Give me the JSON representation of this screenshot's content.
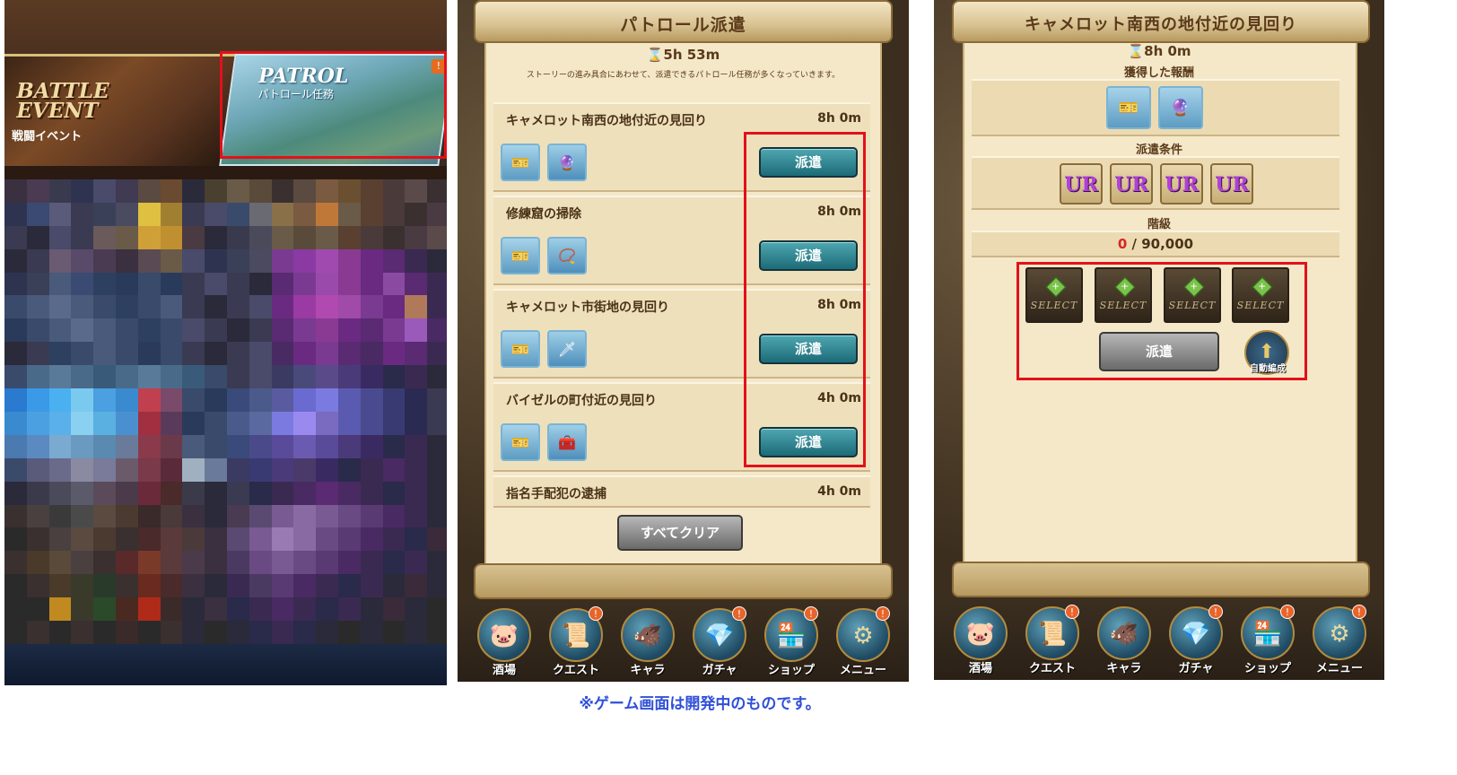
{
  "panel1": {
    "battle_title": "BATTLE EVENT",
    "battle_subtitle": "戦闘イベント",
    "patrol_title": "PATROL",
    "patrol_subtitle": "パトロール任務",
    "patrol_badge": "!",
    "mosaic_colors": [
      "#3a3040",
      "#4a3a52",
      "#3a3a4e",
      "#2e3450",
      "#4a4a6a",
      "#403a52",
      "#5a4a40",
      "#6a4a30",
      "#2a2a3a",
      "#4a4030",
      "#6a5a48",
      "#5a4a3a",
      "#3a3030",
      "#5a4a40",
      "#7a5a40",
      "#6a5030",
      "#5a4030",
      "#4a3a3a",
      "#5a4a4a",
      "#3a3032",
      "#2e3450",
      "#3a4a72",
      "#5a5a7a",
      "#3a3a52",
      "#3a4058",
      "#4a4a60",
      "#e0c040",
      "#a08030",
      "#3a3a52",
      "#4a4a6a",
      "#3a4a6a",
      "#6a6a72",
      "#8a7048",
      "#7a5a40",
      "#c07838",
      "#6a5a48",
      "#5a4030",
      "#4a3a3a",
      "#3a3030",
      "#4a3a42",
      "#3a3a52",
      "#2a2a3a",
      "#4a4a6a",
      "#3a3a52",
      "#6a5a5a",
      "#6a5a48",
      "#d0a038",
      "#c09030",
      "#4a3a42",
      "#2a2a3a",
      "#3a3a4e",
      "#4a4a5a",
      "#6a5a48",
      "#5a4a3a",
      "#6a5a48",
      "#5a4030",
      "#4a3a3a",
      "#3a3030",
      "#4a3a42",
      "#5a4a4a",
      "#2a2a3a",
      "#3a3a52",
      "#6a5a72",
      "#5a4a6a",
      "#4a3a52",
      "#3a3040",
      "#5a4a52",
      "#6a5a48",
      "#4a4a6a",
      "#2e3450",
      "#3a4058",
      "#4a4a60",
      "#7a3a92",
      "#8a3aa2",
      "#a04ab0",
      "#8a3a92",
      "#6a2a82",
      "#5a2a72",
      "#3a2a52",
      "#2a2a3a",
      "#2e3450",
      "#3a4058",
      "#4a5a7a",
      "#3a4a72",
      "#2e4060",
      "#2a3a5a",
      "#3a4a6a",
      "#2a3a5a",
      "#3a3a52",
      "#4a4a6a",
      "#3a3a52",
      "#2a2a3a",
      "#5a2a72",
      "#7a3a92",
      "#9a4aaa",
      "#8a3a92",
      "#6a2a82",
      "#8a4aa2",
      "#5a2a72",
      "#3a2a52",
      "#3a4a6a",
      "#4a5a7a",
      "#5a6a8a",
      "#4a5a7a",
      "#3a4a6a",
      "#2e4060",
      "#3a4a6a",
      "#4a5a7a",
      "#3a3a52",
      "#2a2a3a",
      "#3a3a52",
      "#4a4a6a",
      "#6a2a82",
      "#9a3aa2",
      "#b04ab0",
      "#a04aaa",
      "#7a3a92",
      "#6a2a82",
      "#b07a5a",
      "#3a2a52",
      "#2a3a5a",
      "#3a4a6a",
      "#4a5a7a",
      "#5a6a8a",
      "#4a5a7a",
      "#3a4a6a",
      "#2e4060",
      "#3a4a6a",
      "#4a4a6a",
      "#3a3a52",
      "#2a2a3a",
      "#3a3a52",
      "#5a2a72",
      "#7a3a92",
      "#8a3a92",
      "#6a2a82",
      "#5a2a72",
      "#7a3a92",
      "#9a5aba",
      "#4a2a62",
      "#2a2a3a",
      "#3a3a52",
      "#2e4060",
      "#3a4a6a",
      "#4a5a7a",
      "#3a4a6a",
      "#2a3a5a",
      "#3a4a6a",
      "#3a3a52",
      "#2a2a3a",
      "#3a3a52",
      "#4a4a6a",
      "#4a2a62",
      "#6a2a82",
      "#7a3a92",
      "#5a2a72",
      "#4a2a62",
      "#6a2a82",
      "#5a2a72",
      "#3a2a52",
      "#3a4a6a",
      "#4a6a8a",
      "#5a7a9a",
      "#4a6a8a",
      "#3a5a7a",
      "#4a6a8a",
      "#5a7a9a",
      "#4a6a8a",
      "#3a5a7a",
      "#3a4a6a",
      "#3a3a52",
      "#4a4a6a",
      "#3a3a62",
      "#4a4a7a",
      "#5a4a8a",
      "#4a3a7a",
      "#3a2a62",
      "#2a2a4a",
      "#3a2a52",
      "#2a2a3a",
      "#2a7ad0",
      "#3a9ae8",
      "#4ab0f0",
      "#7acaf0",
      "#4aa0e0",
      "#3a8ad0",
      "#c04050",
      "#7a4a6a",
      "#3a4a6a",
      "#2a3a5a",
      "#3a4a7a",
      "#4a5a8a",
      "#5a5aa0",
      "#6a6ad0",
      "#7a7ae0",
      "#5a5ab0",
      "#4a4a90",
      "#3a3a72",
      "#2a2a52",
      "#3a3a52",
      "#3a8ad0",
      "#4aa0e0",
      "#5ab0e8",
      "#8ad0f0",
      "#5ab0e0",
      "#4a90d0",
      "#a03040",
      "#5a3a5a",
      "#2a3a5a",
      "#3a4a6a",
      "#4a5a8a",
      "#5a6aa0",
      "#7a7ae0",
      "#9a8af0",
      "#7a6ac0",
      "#5a5ab0",
      "#4a4a90",
      "#3a3a72",
      "#2a2a52",
      "#3a3a52",
      "#4a7ab0",
      "#5a8ac0",
      "#7aaad0",
      "#6a9ac0",
      "#5a8ab0",
      "#6a7a9a",
      "#8a3a4a",
      "#6a3a4a",
      "#4a5a7a",
      "#3a4a6a",
      "#3a4a7a",
      "#4a4a8a",
      "#5a4a9a",
      "#6a5ab0",
      "#5a4a9a",
      "#4a3a7a",
      "#3a2a62",
      "#2a2a4a",
      "#3a2a52",
      "#2a2a3a",
      "#3a4a6a",
      "#5a5a7a",
      "#6a6a8a",
      "#8a8aa0",
      "#7a7a9a",
      "#6a5a6a",
      "#7a3a4a",
      "#5a2a3a",
      "#a0b0c0",
      "#6a7a9a",
      "#3a3a62",
      "#3a3a72",
      "#4a3a7a",
      "#4a3a6a",
      "#3a2a62",
      "#2a2a4a",
      "#3a2a52",
      "#4a2a62",
      "#3a2a52",
      "#2a2a3a",
      "#2a2a3a",
      "#3a3a4a",
      "#4a4a5a",
      "#5a5a6a",
      "#5a4a5a",
      "#4a3a4a",
      "#6a2a3a",
      "#4a2a2a",
      "#3a3a4a",
      "#2a2a3a",
      "#3a3a52",
      "#2a2a4a",
      "#3a2a52",
      "#4a2a62",
      "#5a2a72",
      "#4a2a62",
      "#3a2a52",
      "#2a2a4a",
      "#3a2a52",
      "#2a2a3a",
      "#3a3030",
      "#4a4040",
      "#3a3a3a",
      "#4a4a4a",
      "#5a4a40",
      "#4a3a30",
      "#3a2a2a",
      "#4a3a3a",
      "#3a3040",
      "#2a2a3a",
      "#4a3a52",
      "#5a4a72",
      "#7a5a92",
      "#8a6aa2",
      "#7a5a92",
      "#6a4a82",
      "#5a3a72",
      "#4a2a62",
      "#3a2a52",
      "#2a2a3a",
      "#2a2a2a",
      "#3a3030",
      "#4a4040",
      "#5a4a40",
      "#4a3a30",
      "#3a3030",
      "#4a2a2a",
      "#5a3a3a",
      "#4a3a3a",
      "#3a3040",
      "#5a4a72",
      "#7a5a92",
      "#9a7ab2",
      "#8a6aa2",
      "#6a4a82",
      "#5a3a72",
      "#4a2a62",
      "#3a2a52",
      "#2a2a4a",
      "#3a2a3a",
      "#3a3030",
      "#4a3a2a",
      "#5a4a3a",
      "#4a4040",
      "#3a3030",
      "#5a2a2a",
      "#7a3a2a",
      "#5a3a3a",
      "#4a3a4a",
      "#3a3040",
      "#4a3a62",
      "#6a4a82",
      "#7a5a92",
      "#6a4a82",
      "#5a3a72",
      "#4a2a62",
      "#3a2a52",
      "#2a2a4a",
      "#3a2a52",
      "#2a2a3a",
      "#2a2a2a",
      "#3a3030",
      "#4a3a2a",
      "#3a3a2a",
      "#2a3a2a",
      "#3a3030",
      "#6a2a20",
      "#4a2a2a",
      "#3a3040",
      "#2a2a3a",
      "#3a2a52",
      "#4a3a62",
      "#5a3a72",
      "#4a2a62",
      "#3a2a52",
      "#2a2a4a",
      "#3a2a52",
      "#2a2a3a",
      "#3a2a3a",
      "#2a2a3a",
      "#2a2a2a",
      "#2a2a2a",
      "#c08a20",
      "#3a3a2a",
      "#2a4a2a",
      "#4a2a20",
      "#b02a1a",
      "#3a2a2a",
      "#2a2a3a",
      "#3a3040",
      "#2a2a4a",
      "#3a2a52",
      "#4a2a62",
      "#3a2a52",
      "#2a2a4a",
      "#3a2a52",
      "#2a2a3a",
      "#3a2a3a",
      "#2a2a3a",
      "#2a2a2a",
      "#2a2a2a",
      "#3a3030",
      "#2a2a2a",
      "#3a3030",
      "#2a2a2a",
      "#3a2a2a",
      "#2a2a2a",
      "#3a3030",
      "#2a2a3a",
      "#2a2a2a",
      "#2a2a3a",
      "#2a2a4a",
      "#3a2a52",
      "#2a2a4a",
      "#2a2a3a",
      "#2a2a2a",
      "#2a2a3a",
      "#2a2a2a",
      "#2a2a3a",
      "#2a2a2a"
    ]
  },
  "panel2": {
    "title": "パトロール派遣",
    "timer": "⌛5h 53m",
    "description": "ストーリーの進み具合にあわせて、派遣できるパトロール任務が多くなっていきます。",
    "missions": [
      {
        "name": "キャメロット南西の地付近の見回り",
        "time": "8h 0m",
        "button": "派遣",
        "item1": "🎫",
        "item2": "🔮"
      },
      {
        "name": "修練窟の掃除",
        "time": "8h 0m",
        "button": "派遣",
        "item1": "🎫",
        "item2": "📿"
      },
      {
        "name": "キャメロット市街地の見回り",
        "time": "8h 0m",
        "button": "派遣",
        "item1": "🎫",
        "item2": "🗡"
      },
      {
        "name": "バイゼルの町付近の見回り",
        "time": "4h 0m",
        "button": "派遣",
        "item1": "🎫",
        "item2": "🧰"
      },
      {
        "name": "指名手配犯の逮捕",
        "time": "4h 0m"
      }
    ],
    "clear_all": "すべてクリア"
  },
  "panel3": {
    "title": "キャメロット南西の地付近の見回り",
    "timer": "⌛8h 0m",
    "rewards_label": "獲得した報酬",
    "rewards": [
      "🎫",
      "🔮"
    ],
    "conditions_label": "派遣条件",
    "ur_cards": [
      "UR",
      "UR",
      "UR",
      "UR"
    ],
    "rank_label": "階級",
    "progress_current": "0",
    "progress_rest": " / 90,000",
    "slots": [
      "SELECT",
      "SELECT",
      "SELECT",
      "SELECT"
    ],
    "dispatch": "派遣",
    "auto_form": "自動編成"
  },
  "nav": [
    {
      "label": "酒場",
      "icon": "🐷",
      "badge": ""
    },
    {
      "label": "クエスト",
      "icon": "📜",
      "badge": "!"
    },
    {
      "label": "キャラ",
      "icon": "🐗",
      "badge": ""
    },
    {
      "label": "ガチャ",
      "icon": "💎",
      "badge": "!"
    },
    {
      "label": "ショップ",
      "icon": "🏪",
      "badge": "!"
    },
    {
      "label": "メニュー",
      "icon": "⚙",
      "badge": "!"
    }
  ],
  "caption": "※ゲーム画面は開発中のものです。",
  "colors": {
    "highlight": "#e3101a",
    "caption": "#3050d8",
    "teal_button": "#1c6b78"
  }
}
